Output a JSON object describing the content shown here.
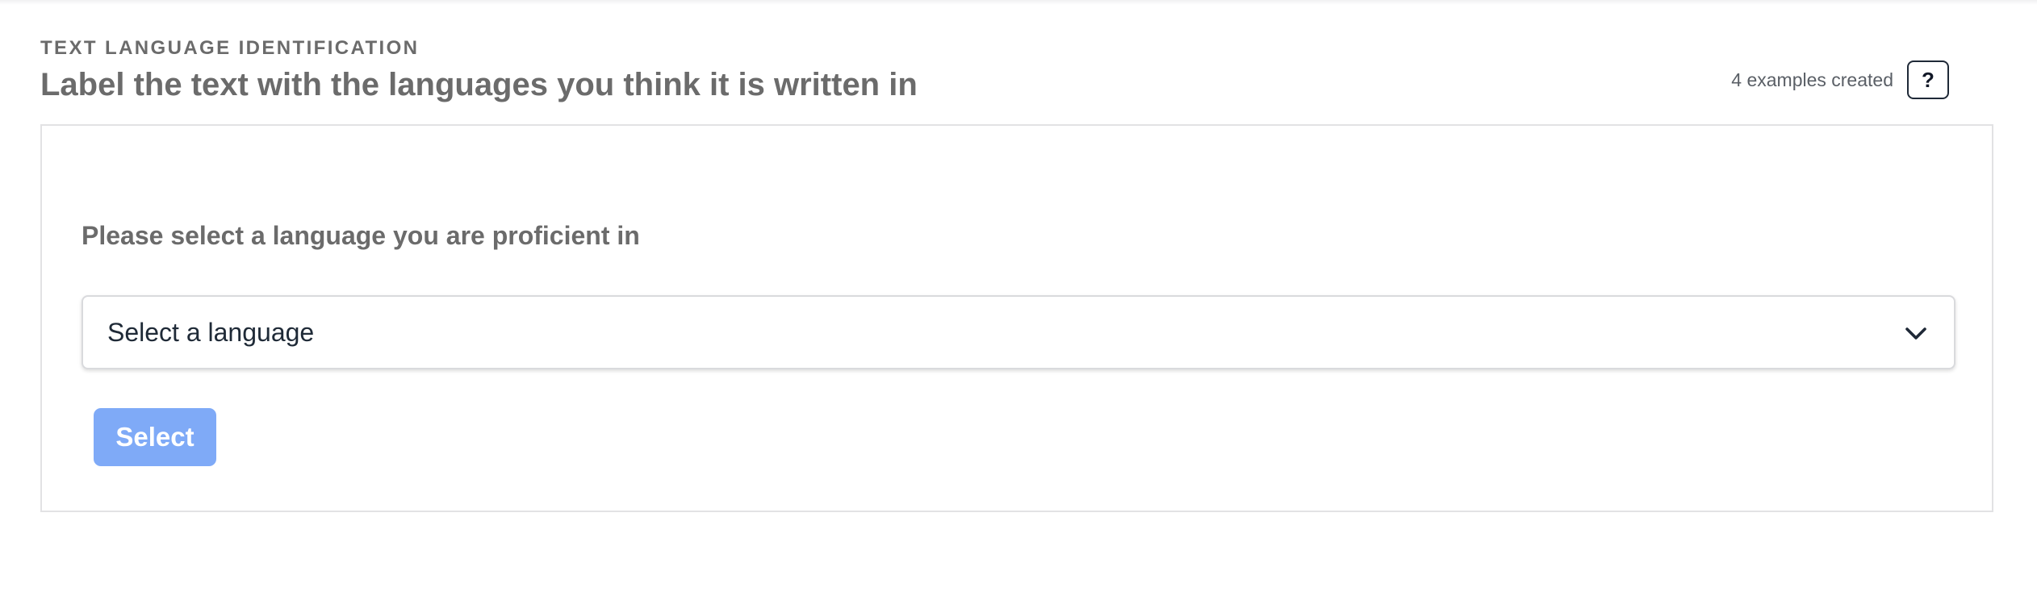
{
  "header": {
    "eyebrow": "TEXT LANGUAGE IDENTIFICATION",
    "title": "Label the text with the languages you think it is written in",
    "examples_count": "4 examples created",
    "help_label": "?"
  },
  "card": {
    "prompt": "Please select a language you are proficient in",
    "language_select": {
      "selected_value": "Select a language",
      "icon": "chevron-down-icon"
    },
    "select_button_label": "Select"
  },
  "colors": {
    "heading_text": "#6b6b6b",
    "primary_button_disabled": "#7faaf7",
    "card_border": "#e2e2e4"
  }
}
